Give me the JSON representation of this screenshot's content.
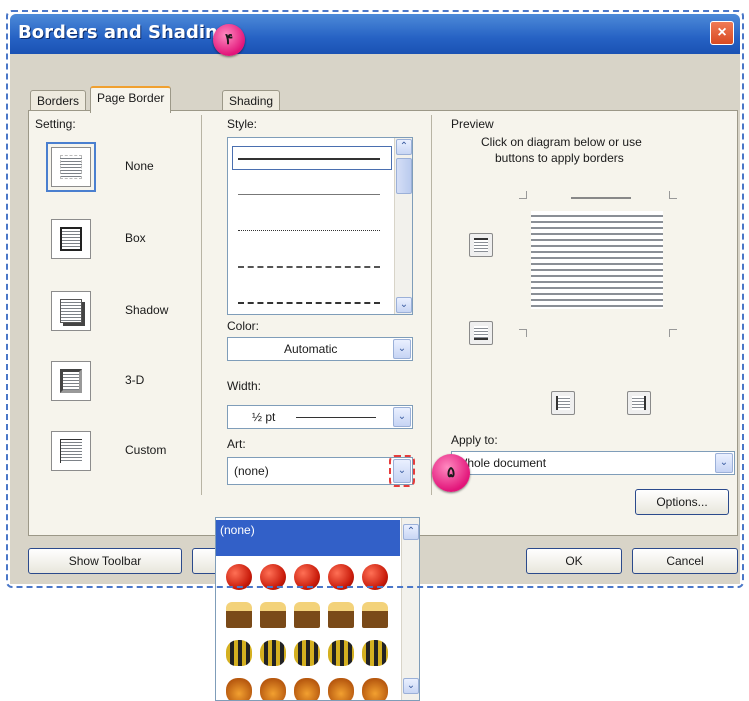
{
  "dialog": {
    "title": "Borders and Shading",
    "close_glyph": "×"
  },
  "badges": {
    "step4": "۴",
    "step5": "۵"
  },
  "tabs": [
    {
      "label": "Borders",
      "active": false
    },
    {
      "label": "Page Border",
      "active": true
    },
    {
      "label": "Shading",
      "active": false
    }
  ],
  "setting": {
    "heading": "Setting:",
    "options": [
      {
        "label": "None",
        "icon": "setting-none-icon",
        "selected": true
      },
      {
        "label": "Box",
        "icon": "setting-box-icon"
      },
      {
        "label": "Shadow",
        "icon": "setting-shadow-icon"
      },
      {
        "label": "3-D",
        "icon": "setting-3d-icon"
      },
      {
        "label": "Custom",
        "icon": "setting-custom-icon"
      }
    ]
  },
  "style": {
    "heading": "Style:",
    "options": [
      "solid",
      "solid-thin",
      "dotted",
      "dashed",
      "dash-dot"
    ],
    "selected_index": 0
  },
  "color": {
    "heading": "Color:",
    "value": "Automatic"
  },
  "width": {
    "heading": "Width:",
    "value": "½ pt"
  },
  "art": {
    "heading": "Art:",
    "value": "(none)",
    "list_selected": "(none)",
    "list_items": [
      "apples",
      "cakes",
      "bugs",
      "pumpkins"
    ]
  },
  "preview": {
    "heading": "Preview",
    "instruction_line1": "Click on diagram below or use",
    "instruction_line2": "buttons to apply borders"
  },
  "apply_to": {
    "heading": "Apply to:",
    "value": "Whole document"
  },
  "buttons": {
    "options": "Options...",
    "show_toolbar": "Show Toolbar",
    "ok": "OK",
    "cancel": "Cancel"
  },
  "icons": {
    "dropdown_arrow": "⌄",
    "scroll_up": "⌃",
    "scroll_down": "⌄"
  },
  "colors": {
    "title_bar": "#2662c4",
    "selection": "#3260c8",
    "highlight_badge": "#e2157a",
    "dialog_bg": "#d8d4c8"
  }
}
